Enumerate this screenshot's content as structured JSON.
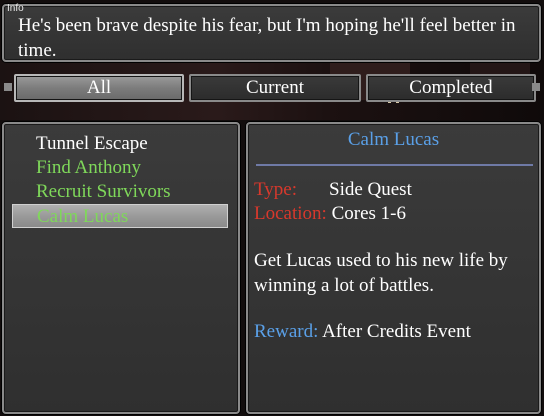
{
  "colors": {
    "quest_white": "#ffffff",
    "quest_green": "#7fd85a",
    "title_blue": "#5aa0e8",
    "label_red": "#d8382c",
    "reward_blue": "#5aa0e8"
  },
  "info": {
    "label": "Info",
    "text": "He's been brave despite his fear, but I'm hoping he'll feel better in time."
  },
  "tabs": [
    {
      "label": "All",
      "active": true
    },
    {
      "label": "Current",
      "active": false
    },
    {
      "label": "Completed",
      "active": false
    }
  ],
  "quests": [
    {
      "name": "Tunnel Escape",
      "color": "#ffffff",
      "selected": false
    },
    {
      "name": "Find Anthony",
      "color": "#7fd85a",
      "selected": false
    },
    {
      "name": "Recruit Survivors",
      "color": "#7fd85a",
      "selected": false
    },
    {
      "name": "Calm Lucas",
      "color": "#7fd85a",
      "selected": true
    }
  ],
  "detail": {
    "title": "Calm Lucas",
    "type_label": "Type:",
    "type_value": "Side Quest",
    "location_label": "Location:",
    "location_value": "Cores 1-6",
    "description": "Get Lucas used to his new life by winning a lot of battles.",
    "reward_label": "Reward:",
    "reward_value": "After Credits Event"
  }
}
